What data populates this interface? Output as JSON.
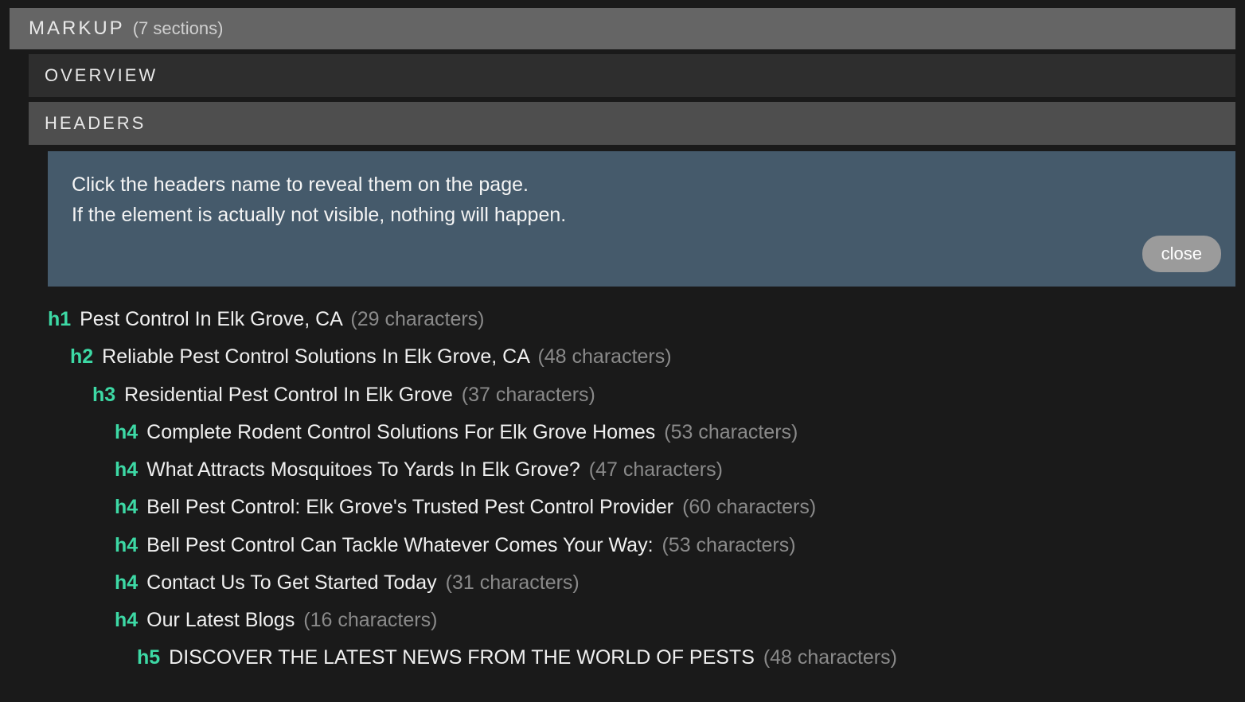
{
  "markup": {
    "title": "MARKUP",
    "sections_meta": "(7 sections)"
  },
  "subsections": {
    "overview": "OVERVIEW",
    "headers": "HEADERS"
  },
  "infobox": {
    "line1": "Click the headers name to reveal them on the page.",
    "line2": "If the element is actually not visible, nothing will happen.",
    "close_label": "close"
  },
  "headers": [
    {
      "level": "h1",
      "indent": 1,
      "text": "Pest Control In Elk Grove, CA",
      "count": "(29 characters)"
    },
    {
      "level": "h2",
      "indent": 2,
      "text": "Reliable Pest Control Solutions In Elk Grove, CA",
      "count": "(48 characters)"
    },
    {
      "level": "h3",
      "indent": 3,
      "text": "Residential Pest Control In Elk Grove",
      "count": "(37 characters)"
    },
    {
      "level": "h4",
      "indent": 4,
      "text": "Complete Rodent Control Solutions For Elk Grove Homes",
      "count": "(53 characters)"
    },
    {
      "level": "h4",
      "indent": 4,
      "text": "What Attracts Mosquitoes To Yards In Elk Grove?",
      "count": "(47 characters)"
    },
    {
      "level": "h4",
      "indent": 4,
      "text": "Bell Pest Control: Elk Grove's Trusted Pest Control Provider",
      "count": "(60 characters)"
    },
    {
      "level": "h4",
      "indent": 4,
      "text": "Bell Pest Control Can Tackle Whatever Comes Your Way:",
      "count": "(53 characters)"
    },
    {
      "level": "h4",
      "indent": 4,
      "text": "Contact Us To Get Started Today",
      "count": "(31 characters)"
    },
    {
      "level": "h4",
      "indent": 4,
      "text": "Our Latest Blogs",
      "count": "(16 characters)"
    },
    {
      "level": "h5",
      "indent": 5,
      "text": "DISCOVER THE LATEST NEWS FROM THE WORLD OF PESTS",
      "count": "(48 characters)"
    }
  ]
}
